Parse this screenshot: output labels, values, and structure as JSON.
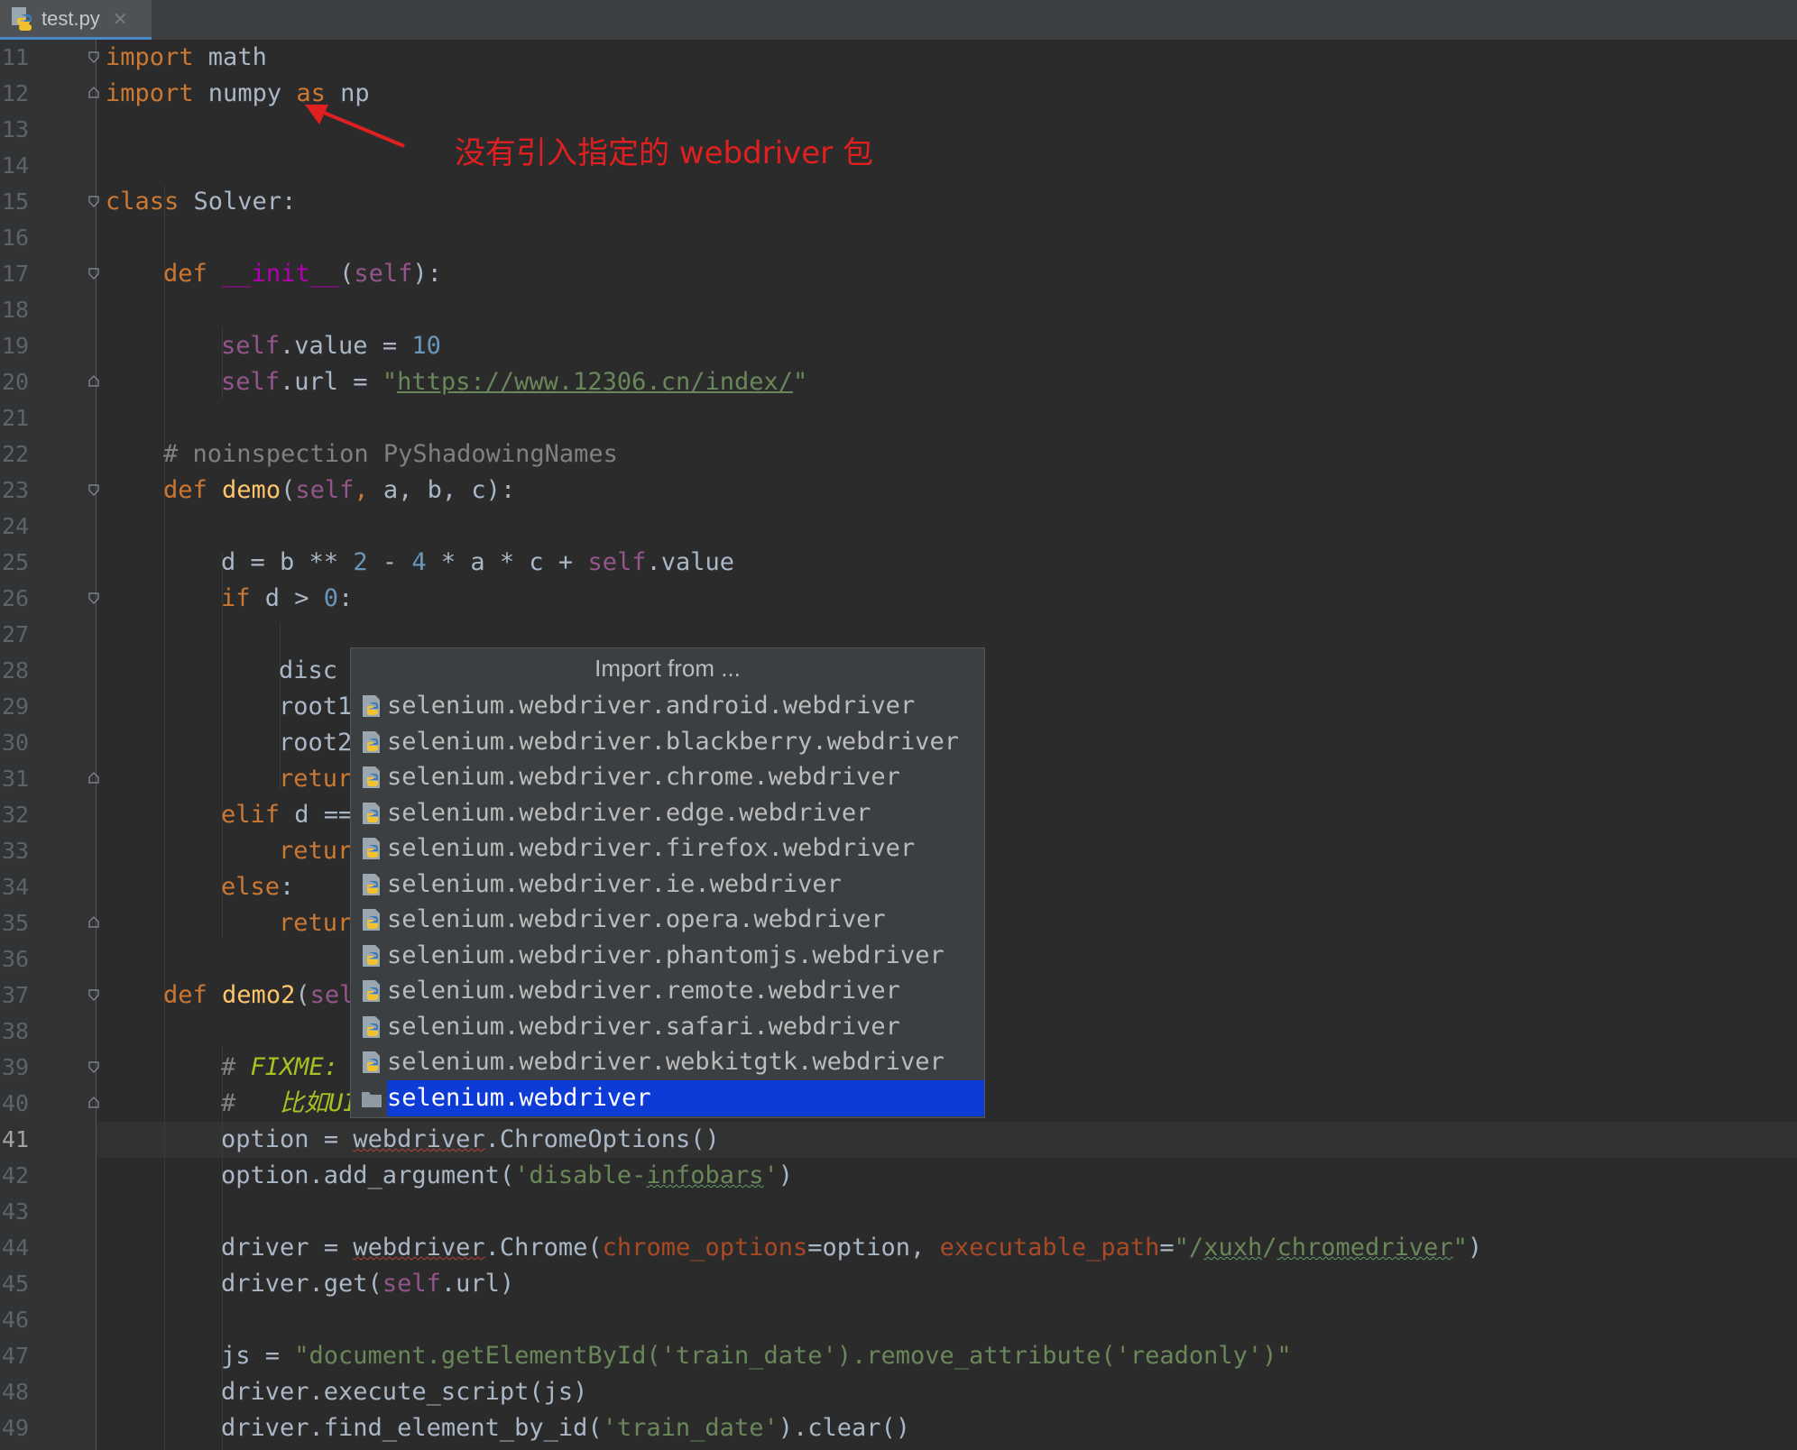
{
  "tab": {
    "filename": "test.py",
    "close_glyph": "✕",
    "icon": "python-file-icon"
  },
  "colors": {
    "editor_bg": "#2b2b2b",
    "keyword": "#cc7832",
    "function": "#ffc66d",
    "self": "#94558d",
    "number": "#6897bb",
    "string": "#6a8759",
    "comment": "#808080",
    "selection": "#0d3bd6",
    "annotation": "#e02020"
  },
  "annotation": {
    "text": "没有引入指定的 webdriver 包"
  },
  "editor": {
    "current_line": 41,
    "line_numbers": [
      "11",
      "12",
      "13",
      "14",
      "15",
      "16",
      "17",
      "18",
      "19",
      "20",
      "21",
      "22",
      "23",
      "24",
      "25",
      "26",
      "27",
      "28",
      "29",
      "30",
      "31",
      "32",
      "33",
      "34",
      "35",
      "36",
      "37",
      "38",
      "39",
      "40",
      "41",
      "42",
      "43",
      "44",
      "45",
      "46",
      "47",
      "48",
      "49"
    ],
    "code": {
      "l11_import": "import",
      "l11_mod": " math",
      "l12_import": "import",
      "l12_mod": " numpy ",
      "l12_as": "as",
      "l12_alias": " np",
      "l15_class": "class",
      "l15_name": " Solver:",
      "l17_def": "def",
      "l17_init": "__init__",
      "l17_open": "(",
      "l17_self": "self",
      "l17_close": "):",
      "l19_self": "self",
      "l19_rest": ".value = ",
      "l19_num": "10",
      "l20_self": "self",
      "l20_rest": ".url = ",
      "l20_q1": "\"",
      "l20_url": "https://www.12306.cn/index/",
      "l20_q2": "\"",
      "l22_comment": "# noinspection PyShadowingNames",
      "l23_def": "def",
      "l23_name": "demo",
      "l23_open": "(",
      "l23_self": "self",
      "l23_comma": ",",
      "l23_args": " a, b, c):",
      "l25_a": "d = b ** ",
      "l25_n2": "2",
      "l25_b": " - ",
      "l25_n4": "4",
      "l25_c": " * a * c + ",
      "l25_self": "self",
      "l25_d": ".value",
      "l26_if": "if",
      "l26_mid": " d > ",
      "l26_zero": "0",
      "l26_end": ":",
      "l28": "disc",
      "l29": "root1",
      "l30": "root2",
      "l31": "retur",
      "l32_elif": "elif",
      "l32_rest": " d ==",
      "l33": "retur",
      "l34_else": "else",
      "l34_colon": ":",
      "l35": "retur",
      "l37_def": "def",
      "l37_name": "demo2",
      "l37_open": "(",
      "l37_self": "sel",
      "l39_hash": "# ",
      "l39_fixme": "FIXME:",
      "l40_hash": "#   ",
      "l40_text": "比如UI",
      "l41_a": "option = ",
      "l41_wd": "webdriver",
      "l41_b": ".ChromeOptions()",
      "l42_a": "option.add_argument(",
      "l42_s1": "'disable-",
      "l42_typo": "infobars",
      "l42_s2": "'",
      "l42_b": ")",
      "l44_a": "driver = ",
      "l44_wd": "webdriver",
      "l44_b": ".Chrome(",
      "l44_p1": "chrome_options",
      "l44_c": "=option, ",
      "l44_p2": "executable_path",
      "l44_d": "=",
      "l44_s1": "\"/",
      "l44_t1": "xuxh",
      "l44_s2": "/",
      "l44_t2": "chromedriver",
      "l44_s3": "\"",
      "l44_e": ")",
      "l45_a": "driver.get(",
      "l45_self": "self",
      "l45_b": ".url)",
      "l47_a": "js = ",
      "l47_str": "\"document.getElementById('train_date').remove_attribute('readonly')\"",
      "l48": "driver.execute_script(js)",
      "l49_a": "driver.find_element_by_id(",
      "l49_str": "'train_date'",
      "l49_b": ").clear()"
    }
  },
  "import_popup": {
    "title": "Import from ...",
    "items": [
      {
        "label": "selenium.webdriver.android.webdriver",
        "icon": "python-module-icon"
      },
      {
        "label": "selenium.webdriver.blackberry.webdriver",
        "icon": "python-module-icon"
      },
      {
        "label": "selenium.webdriver.chrome.webdriver",
        "icon": "python-module-icon"
      },
      {
        "label": "selenium.webdriver.edge.webdriver",
        "icon": "python-module-icon"
      },
      {
        "label": "selenium.webdriver.firefox.webdriver",
        "icon": "python-module-icon"
      },
      {
        "label": "selenium.webdriver.ie.webdriver",
        "icon": "python-module-icon"
      },
      {
        "label": "selenium.webdriver.opera.webdriver",
        "icon": "python-module-icon"
      },
      {
        "label": "selenium.webdriver.phantomjs.webdriver",
        "icon": "python-module-icon"
      },
      {
        "label": "selenium.webdriver.remote.webdriver",
        "icon": "python-module-icon"
      },
      {
        "label": "selenium.webdriver.safari.webdriver",
        "icon": "python-module-icon"
      },
      {
        "label": "selenium.webdriver.webkitgtk.webdriver",
        "icon": "python-module-icon"
      },
      {
        "label": "selenium.webdriver",
        "icon": "package-folder-icon",
        "selected": true
      }
    ]
  }
}
